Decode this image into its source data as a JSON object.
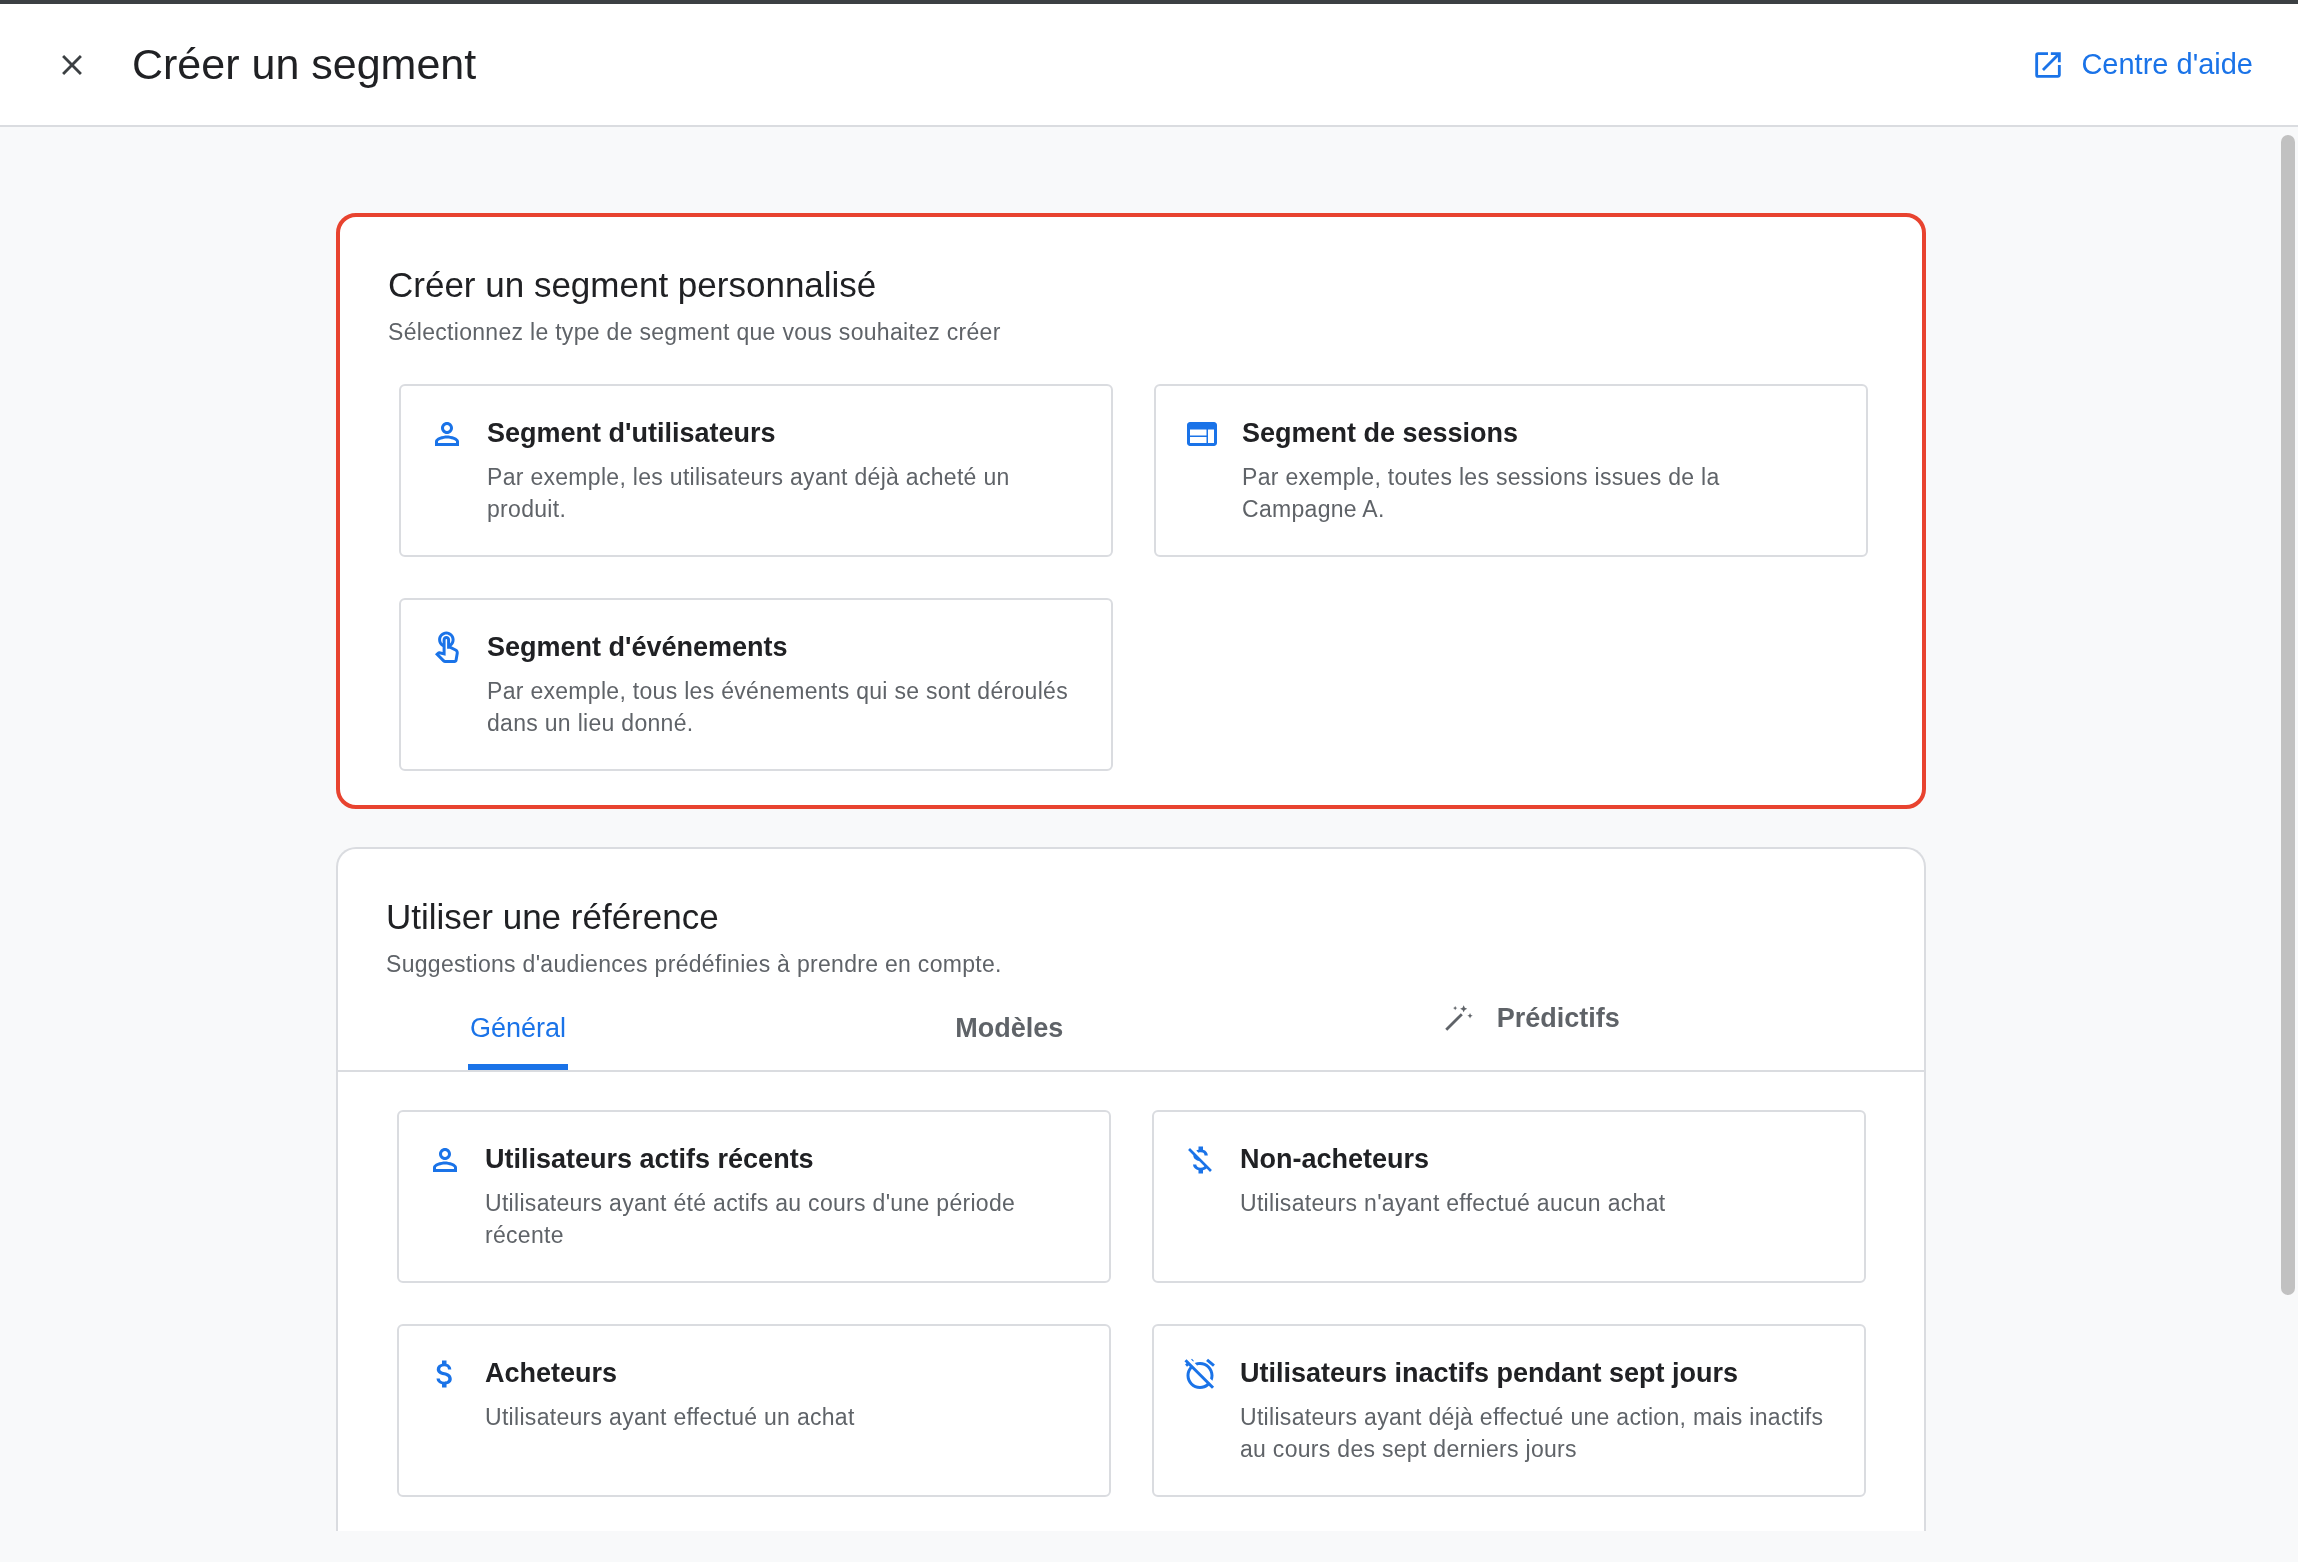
{
  "header": {
    "title": "Créer un segment",
    "help_link": "Centre d'aide"
  },
  "sections": [
    {
      "title": "Créer un segment personnalisé",
      "subtitle": "Sélectionnez le type de segment que vous souhaitez créer",
      "highlighted": true,
      "options": [
        {
          "kind": "users",
          "title": "Segment d'utilisateurs",
          "description": "Par exemple, les utilisateurs ayant déjà acheté un produit."
        },
        {
          "kind": "sessions",
          "title": "Segment de sessions",
          "description": "Par exemple, toutes les sessions issues de la Campagne A."
        },
        {
          "kind": "events",
          "title": "Segment d'événements",
          "description": "Par exemple, tous les événements qui se sont déroulés dans un lieu donné."
        }
      ]
    },
    {
      "title": "Utiliser une référence",
      "subtitle": "Suggestions d'audiences prédéfinies à prendre en compte.",
      "highlighted": false,
      "tabs": [
        {
          "label": "Général",
          "selected": true,
          "kind": "plain"
        },
        {
          "label": "Modèles",
          "selected": false,
          "kind": "plain"
        },
        {
          "label": "Prédictifs",
          "selected": false,
          "kind": "magic"
        }
      ],
      "options": [
        {
          "kind": "users",
          "title": "Utilisateurs actifs récents",
          "description": "Utilisateurs ayant été actifs au cours d'une période récente"
        },
        {
          "kind": "non-buyers",
          "title": "Non-acheteurs",
          "description": "Utilisateurs n'ayant effectué aucun achat"
        },
        {
          "kind": "buyers",
          "title": "Acheteurs",
          "description": "Utilisateurs ayant effectué un achat"
        },
        {
          "kind": "inactive",
          "title": "Utilisateurs inactifs pendant sept jours",
          "description": "Utilisateurs ayant déjà effectué une action, mais inactifs au cours des sept derniers jours"
        }
      ]
    }
  ]
}
